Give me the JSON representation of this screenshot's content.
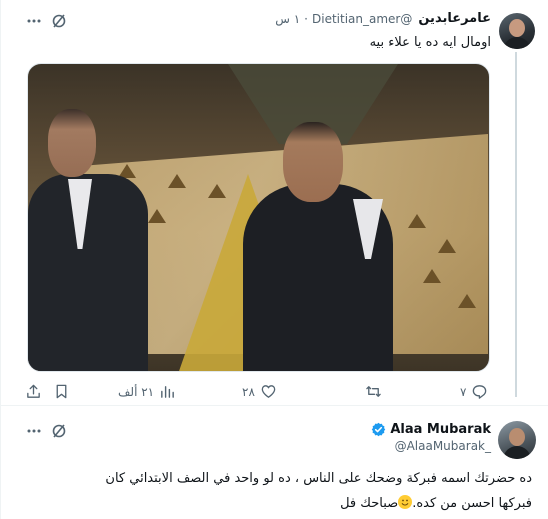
{
  "tweet1": {
    "author_name": "عامر⁪عابدين⁪",
    "author_handle": "@Dietitian_amer",
    "separator": "·",
    "time": "١ س",
    "text": "اومال ايه ده يا علاء بيه",
    "media_icon": "photo",
    "actions": {
      "reply_icon": "reply-icon",
      "reply_count": "٧",
      "retweet_icon": "retweet-icon",
      "retweet_count": "",
      "like_icon": "heart-icon",
      "like_count": "٢٨",
      "views_icon": "views-icon",
      "views_count": "٢١ ألف",
      "bookmark_icon": "bookmark-icon",
      "share_icon": "share-icon"
    }
  },
  "tweet2": {
    "author_name": "Alaa Mubarak",
    "author_handle": "@AlaaMubarak_",
    "verified": true,
    "line1": "ده حضرتك اسمه فبركة وضحك على الناس ،  ده لو واحد في الصف الابتدائي كان",
    "line2_a": "فبركها  احسن من كده.",
    "line2_b": "صباحك فل"
  },
  "colors": {
    "text": "#0f1419",
    "secondary": "#536471",
    "verified": "#1d9bf0",
    "border": "#eff3f4"
  }
}
